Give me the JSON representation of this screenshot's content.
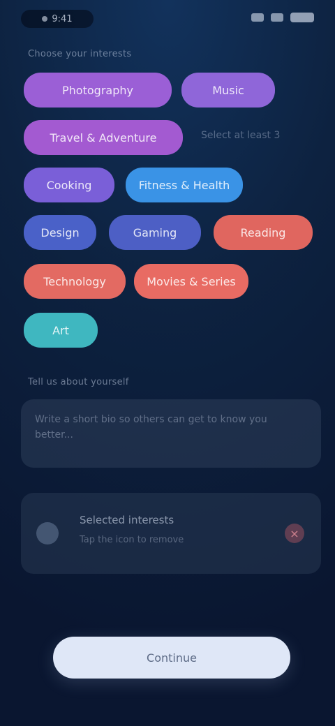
{
  "status_bar": {
    "time": "9:41"
  },
  "interests": {
    "label": "Choose your interests",
    "tags": [
      {
        "label": "Photography",
        "color": "#9b5fd6"
      },
      {
        "label": "Music",
        "color": "#8f66d9"
      },
      {
        "label": "Travel & Adventure",
        "color": "#a35ad1"
      },
      {
        "label": "Cooking",
        "color": "#7a5fd8"
      },
      {
        "label": "Fitness & Health",
        "color": "#3a93e6"
      },
      {
        "label": "Design",
        "color": "#4a61c8"
      },
      {
        "label": "Gaming",
        "color": "#4d5fc5"
      },
      {
        "label": "Reading",
        "color": "#e0665f"
      },
      {
        "label": "Technology",
        "color": "#e36a62"
      },
      {
        "label": "Movies & Series",
        "color": "#e86b63"
      },
      {
        "label": "Art",
        "color": "#3fb7c0"
      }
    ],
    "hint": "Select at least 3"
  },
  "about": {
    "label": "Tell us about yourself",
    "placeholder": "Write a short bio so others can get to know you better..."
  },
  "selected": {
    "title": "Selected interests",
    "subtitle": "Tap the icon to remove"
  },
  "continue_label": "Continue"
}
